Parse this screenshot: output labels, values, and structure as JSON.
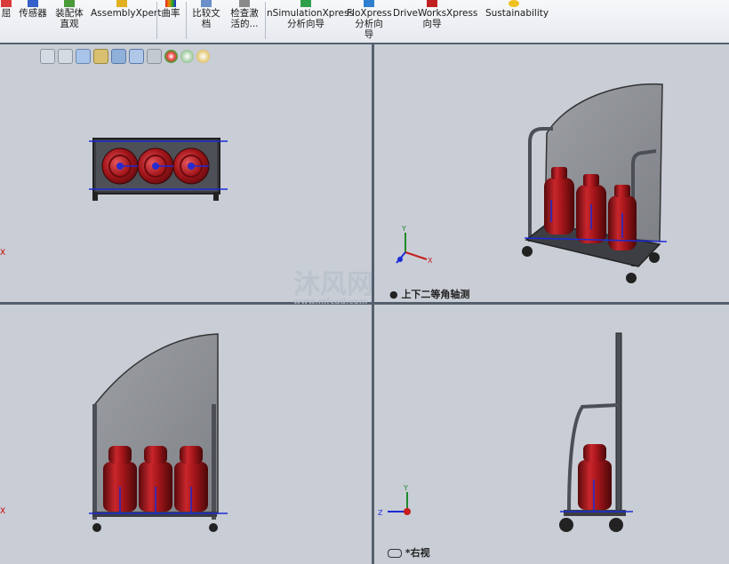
{
  "ribbon": {
    "items": [
      {
        "label": "屈",
        "icon": "partial-icon"
      },
      {
        "label": "传感器",
        "icon": "sensor-icon"
      },
      {
        "label": "装配体\n直观",
        "icon": "assembly-visualization-icon"
      },
      {
        "label": "AssemblyXpert",
        "icon": "assemblyxpert-icon"
      },
      {
        "label": "曲率",
        "icon": "curvature-icon"
      },
      {
        "label": "比较文\n档",
        "icon": "compare-documents-icon"
      },
      {
        "label": "检查激\n活的...",
        "icon": "check-active-icon"
      },
      {
        "label": "nSimulationXpress\n分析向导",
        "icon": "simulationxpress-icon"
      },
      {
        "label": "FloXpress\n分析向\n导",
        "icon": "floxpress-icon"
      },
      {
        "label": "DriveWorksXpress\n向导",
        "icon": "driveworksxpress-icon"
      },
      {
        "label": "Sustainability",
        "icon": "sustainability-icon"
      }
    ]
  },
  "viewports": {
    "top_left": {
      "label": ""
    },
    "top_right": {
      "label": "上下二等角轴测"
    },
    "bottom_left": {
      "label": ""
    },
    "bottom_right": {
      "label": "*右视"
    }
  },
  "watermark": "沐风网",
  "watermark_url": "www.mfcad.com",
  "axis_labels": {
    "x": "X",
    "y": "Y",
    "z": "Z"
  },
  "colors": {
    "cylinder": "#a3151a",
    "frame": "#4c4f55",
    "panel": "#8f9296",
    "accent_blue": "#1a2bd6"
  }
}
